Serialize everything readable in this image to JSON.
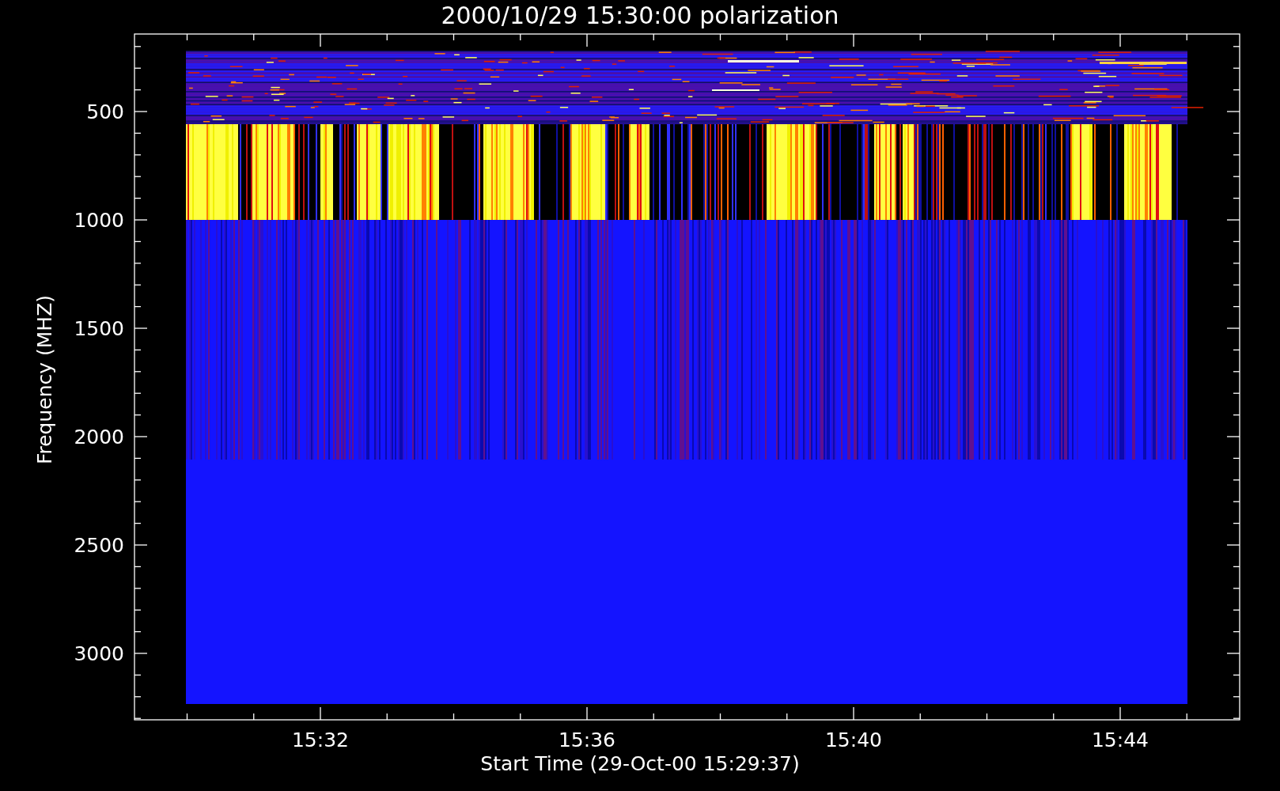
{
  "plot": {
    "title": "2000/10/29 15:30:00 polarization",
    "ylabel": "Frequency (MHZ)",
    "xlabel": "Start Time (29-Oct-00 15:29:37)",
    "yticks": [
      "500",
      "1000",
      "1500",
      "2000",
      "2500",
      "3000"
    ],
    "xticks": [
      "15:32",
      "15:36",
      "15:40",
      "15:44"
    ]
  }
}
